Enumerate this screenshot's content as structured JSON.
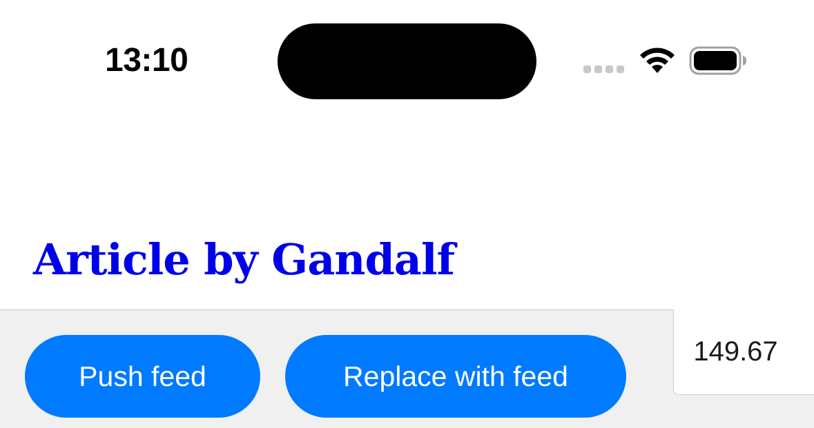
{
  "status_bar": {
    "time": "13:10",
    "icons": [
      "cellular-signal-icon",
      "wifi-icon",
      "battery-icon"
    ]
  },
  "article": {
    "title": "Article by Gandalf",
    "title_color": "#0000e8"
  },
  "toolbar": {
    "push_label": "Push feed",
    "replace_label": "Replace with feed",
    "value": "149.67",
    "button_color": "#007aff",
    "background_color": "#f0f0f0"
  }
}
